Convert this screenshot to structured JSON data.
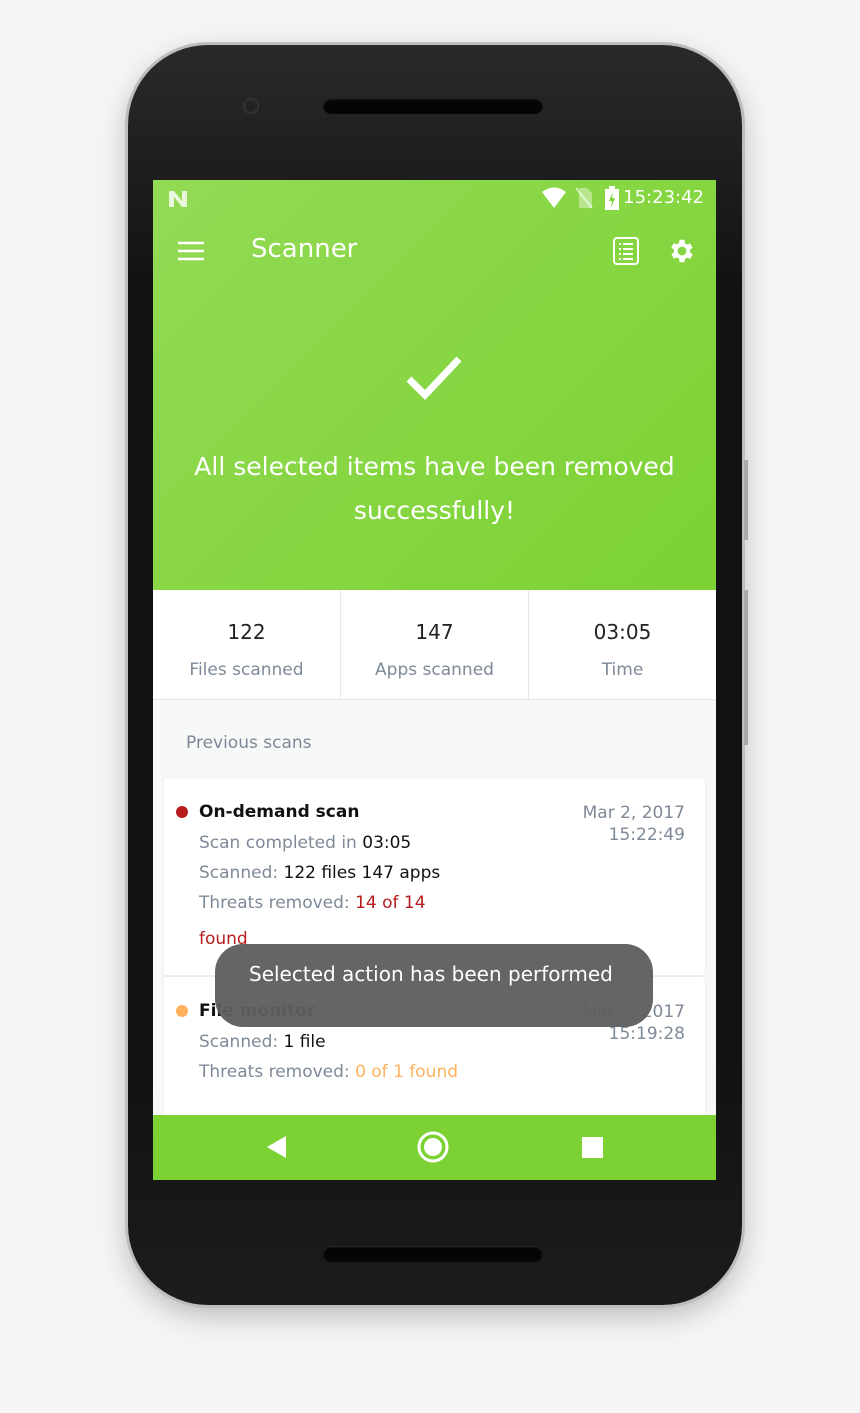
{
  "status_bar": {
    "time": "15:23:42",
    "icons": [
      "n-icon",
      "wifi-icon",
      "no-sim-icon",
      "battery-charging-icon"
    ]
  },
  "app_bar": {
    "title": "Scanner",
    "icons": [
      "menu-icon",
      "report-list-icon",
      "settings-icon"
    ]
  },
  "hero": {
    "icon": "checkmark-icon",
    "message": "All selected items have been removed successfully!"
  },
  "stats": [
    {
      "value": "122",
      "label": "Files scanned"
    },
    {
      "value": "147",
      "label": "Apps scanned"
    },
    {
      "value": "03:05",
      "label": "Time"
    }
  ],
  "previous": {
    "heading": "Previous scans",
    "items": [
      {
        "title": "On-demand scan",
        "date": "Mar 2, 2017",
        "time": "15:22:49",
        "completed_label": "Scan completed in ",
        "completed_value": "03:05",
        "scanned_label": "Scanned: ",
        "scanned_value": "122 files 147 apps",
        "threats_label": "Threats removed: ",
        "threats_value": "14 of 14",
        "threats_value2": "found",
        "status_color": "#b71c1c"
      },
      {
        "title": "File monitor",
        "date": "Mar 2, 2017",
        "time": "15:19:28",
        "scanned_label": "Scanned: ",
        "scanned_value": "1 file",
        "threats_label": "Threats removed: ",
        "threats_value": "0 of 1 found",
        "status_color": "#ffb15c"
      }
    ]
  },
  "toast": "Selected action has been performed",
  "colors": {
    "brand_green": "#7bd232",
    "threat_red": "#b71c1c",
    "warning_orange": "#ffb15c"
  },
  "nav": [
    "back-icon",
    "home-icon",
    "recents-icon"
  ]
}
